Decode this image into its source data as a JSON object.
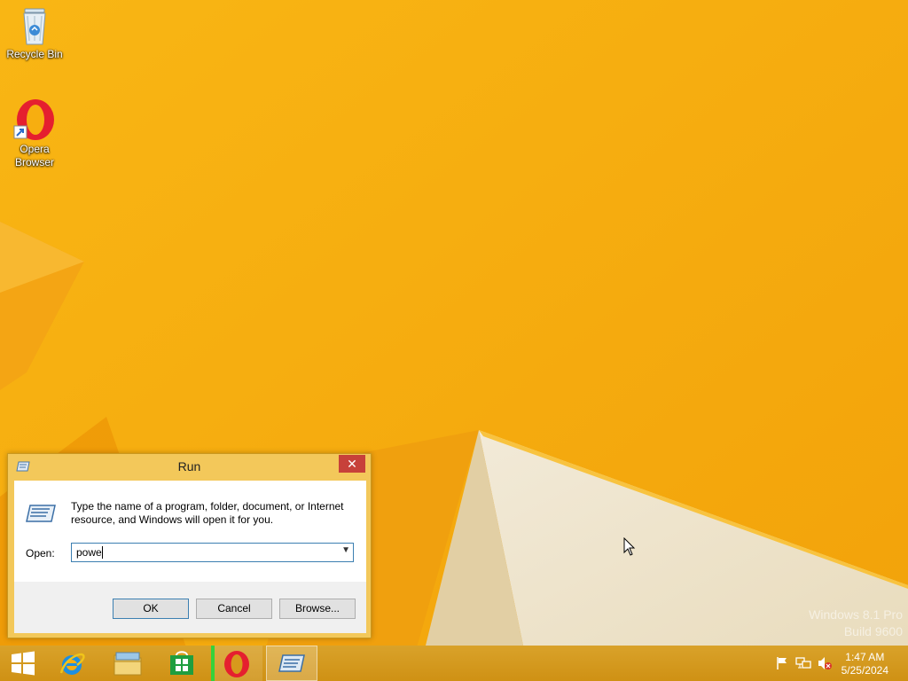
{
  "desktop": {
    "icons": [
      {
        "label": "Recycle Bin",
        "icon": "recycle-bin-icon"
      },
      {
        "label": "Opera\nBrowser",
        "icon": "opera-icon"
      }
    ],
    "watermark": {
      "line1": "Windows 8.1 Pro",
      "line2": "Build 9600"
    }
  },
  "run_dialog": {
    "title": "Run",
    "close_label": "✕",
    "description": "Type the name of a program, folder, document, or Internet resource, and Windows will open it for you.",
    "open_label": "Open:",
    "open_value": "powe",
    "ok_label": "OK",
    "cancel_label": "Cancel",
    "browse_label": "Browse..."
  },
  "taskbar": {
    "items": [
      {
        "name": "start",
        "icon": "windows-logo-icon"
      },
      {
        "name": "internet-explorer",
        "icon": "internet-explorer-icon"
      },
      {
        "name": "file-explorer",
        "icon": "folder-icon"
      },
      {
        "name": "store",
        "icon": "store-icon"
      },
      {
        "name": "opera",
        "icon": "opera-icon"
      },
      {
        "name": "run",
        "icon": "run-icon"
      }
    ],
    "clock": {
      "time": "1:47 AM",
      "date": "5/25/2024"
    }
  },
  "colors": {
    "wallpaper": "#f7ae10",
    "taskbar": "#d79a1c",
    "close_button": "#c7413a",
    "dialog_frame": "#f3c85a"
  }
}
